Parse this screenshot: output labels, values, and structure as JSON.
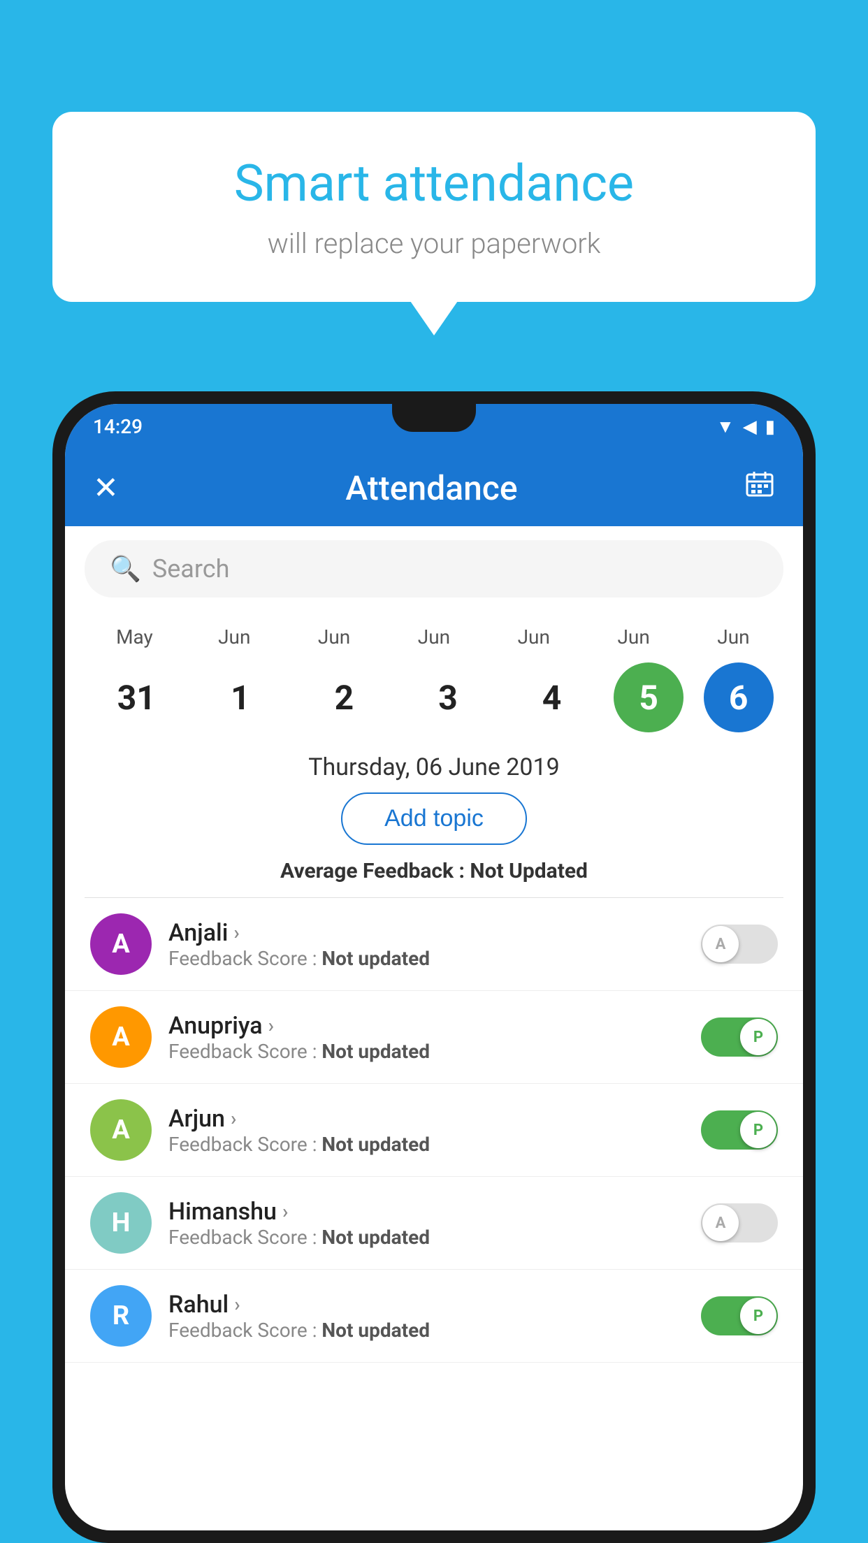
{
  "background_color": "#29b6e8",
  "speech_bubble": {
    "title": "Smart attendance",
    "subtitle": "will replace your paperwork"
  },
  "status_bar": {
    "time": "14:29",
    "icons": [
      "▼",
      "◀",
      "▮"
    ]
  },
  "app_bar": {
    "title": "Attendance",
    "close_icon": "✕",
    "calendar_icon": "📅"
  },
  "search": {
    "placeholder": "Search"
  },
  "calendar": {
    "months": [
      "May",
      "Jun",
      "Jun",
      "Jun",
      "Jun",
      "Jun",
      "Jun"
    ],
    "dates": [
      "31",
      "1",
      "2",
      "3",
      "4",
      "5",
      "6"
    ],
    "today_index": 5,
    "selected_index": 6,
    "selected_date_label": "Thursday, 06 June 2019"
  },
  "add_topic_button": "Add topic",
  "avg_feedback": {
    "label": "Average Feedback : ",
    "value": "Not Updated"
  },
  "students": [
    {
      "name": "Anjali",
      "avatar_letter": "A",
      "avatar_color": "avatar-purple",
      "feedback_label": "Feedback Score : ",
      "feedback_value": "Not updated",
      "toggle_state": "off",
      "toggle_label": "A"
    },
    {
      "name": "Anupriya",
      "avatar_letter": "A",
      "avatar_color": "avatar-orange",
      "feedback_label": "Feedback Score : ",
      "feedback_value": "Not updated",
      "toggle_state": "on",
      "toggle_label": "P"
    },
    {
      "name": "Arjun",
      "avatar_letter": "A",
      "avatar_color": "avatar-green",
      "feedback_label": "Feedback Score : ",
      "feedback_value": "Not updated",
      "toggle_state": "on",
      "toggle_label": "P"
    },
    {
      "name": "Himanshu",
      "avatar_letter": "H",
      "avatar_color": "avatar-teal",
      "feedback_label": "Feedback Score : ",
      "feedback_value": "Not updated",
      "toggle_state": "off",
      "toggle_label": "A"
    },
    {
      "name": "Rahul",
      "avatar_letter": "R",
      "avatar_color": "avatar-blue",
      "feedback_label": "Feedback Score : ",
      "feedback_value": "Not updated",
      "toggle_state": "on",
      "toggle_label": "P"
    }
  ]
}
